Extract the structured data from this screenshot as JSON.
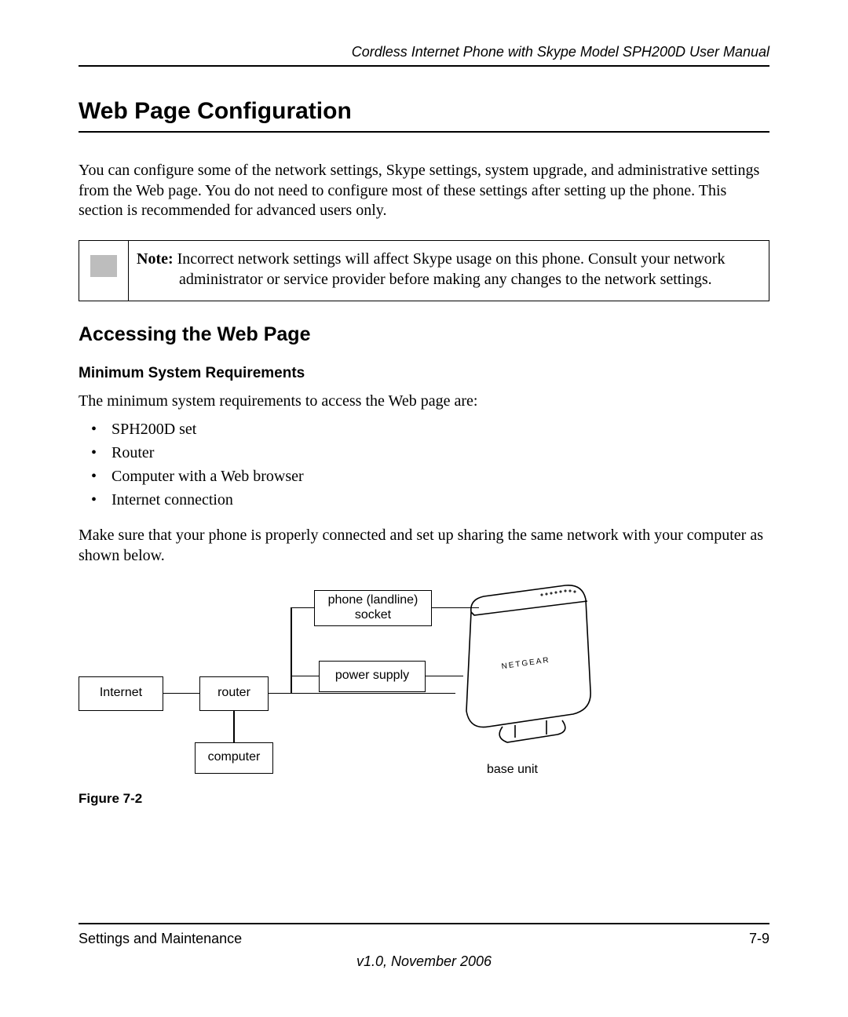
{
  "header": {
    "running": "Cordless Internet Phone with Skype Model SPH200D User Manual"
  },
  "h1": "Web Page Configuration",
  "intro": "You can configure some of the network settings, Skype settings, system upgrade, and administrative settings from the Web page. You do not need to configure most of these settings after setting up the phone. This section is recommended for advanced users only.",
  "note": {
    "label": "Note:",
    "text": "Incorrect network settings will affect Skype usage on this phone. Consult your network administrator or service provider before making any changes to the network settings."
  },
  "h2": "Accessing the Web Page",
  "h3": "Minimum System Requirements",
  "req_intro": "The minimum system requirements to access the Web page are:",
  "requirements": [
    "SPH200D set",
    "Router",
    "Computer with a Web browser",
    "Internet connection"
  ],
  "req_outro": "Make sure that your phone is properly connected and set up sharing the same network with your computer as shown below.",
  "diagram": {
    "internet": "Internet",
    "router": "router",
    "computer": "computer",
    "phone_socket": "phone (landline)\nsocket",
    "power_supply": "power supply",
    "base_unit": "base unit",
    "brand": "NETGEAR"
  },
  "figure_caption": "Figure 7-2",
  "footer": {
    "left": "Settings and Maintenance",
    "right": "7-9",
    "version": "v1.0, November 2006"
  }
}
